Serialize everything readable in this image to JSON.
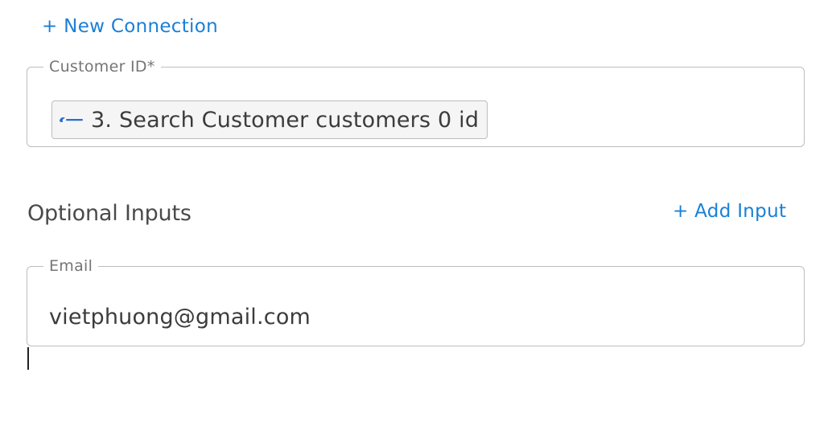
{
  "actions": {
    "new_connection_label": "+ New Connection",
    "add_input_label": "+ Add Input"
  },
  "customer_id": {
    "label": "Customer ID*",
    "chip_text": "3. Search Customer customers 0 id",
    "chip_icon": "app-logo-icon"
  },
  "optional_inputs": {
    "title": "Optional Inputs"
  },
  "email": {
    "label": "Email",
    "value": "vietphuong@gmail.com"
  },
  "colors": {
    "accent": "#1a7fd6",
    "border": "#bdbdbd",
    "text": "#4a4a4a"
  }
}
